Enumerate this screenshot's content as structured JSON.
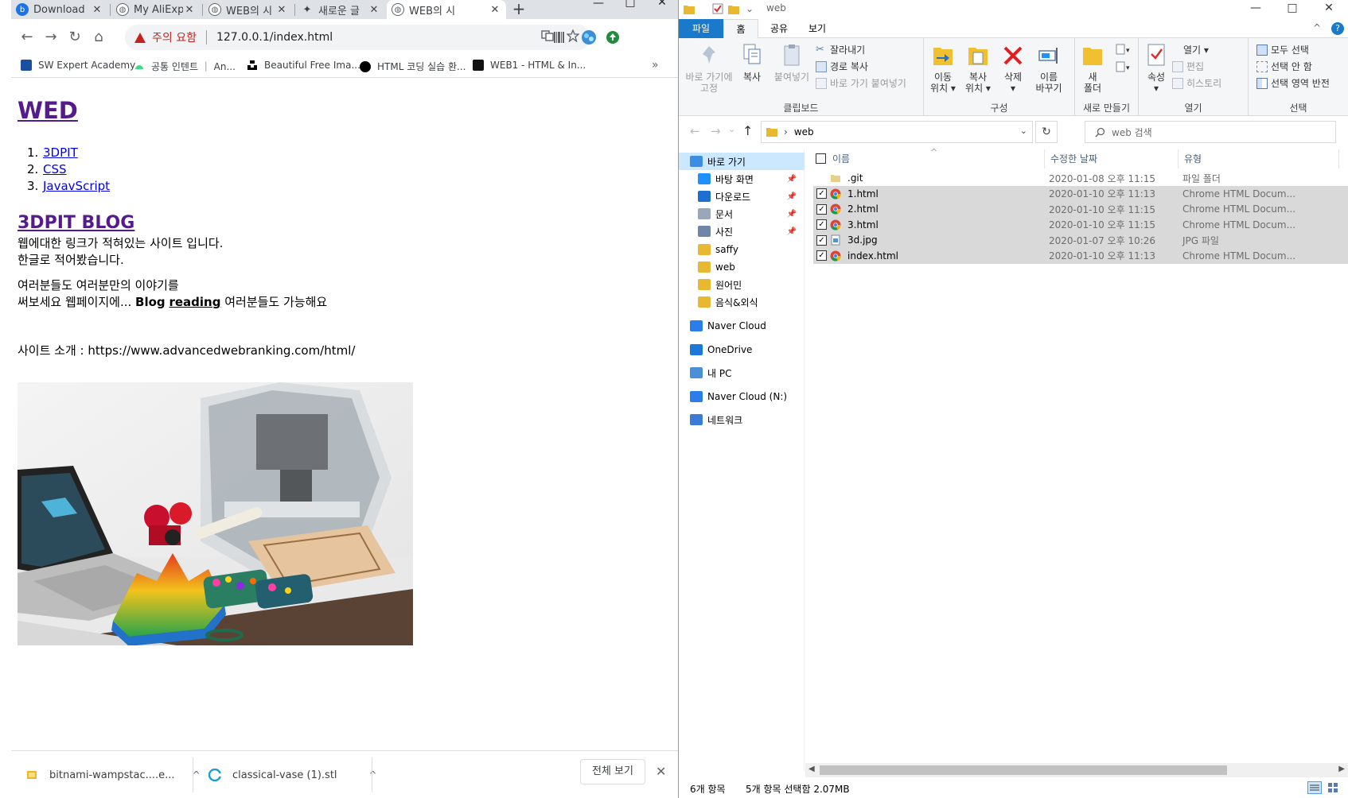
{
  "browser": {
    "tabs": [
      {
        "label": "Download",
        "fav_color": "#1a73e8",
        "fav_glyph": "b"
      },
      {
        "label": "My AliExp",
        "fav_color": "#5f6368",
        "fav_glyph": "◍"
      },
      {
        "label": "WEB의 시",
        "fav_color": "#5f6368",
        "fav_glyph": "◍"
      },
      {
        "label": "새로운 글",
        "fav_color": "#5f6368",
        "fav_glyph": "✦"
      },
      {
        "label": "WEB의 시",
        "fav_color": "#5f6368",
        "fav_glyph": "◍"
      }
    ],
    "newtab_glyph": "+",
    "window_buttons": {
      "minimize": "—",
      "maximize": "□",
      "close": "✕"
    },
    "nav": {
      "back": "←",
      "forward": "→",
      "reload": "↻",
      "home": "⌂"
    },
    "security_label": "주의 요함",
    "url": "127.0.0.1/index.html",
    "bookmarks": [
      {
        "label": "SW Expert Academy",
        "color": "#1a4fa0"
      },
      {
        "label": "공통 인텐트 ｜ An...",
        "color": "#3ddc84"
      },
      {
        "label": "Beautiful Free Ima...",
        "color": "#000000"
      },
      {
        "label": "HTML 코딩 실습 환...",
        "color": "#000000"
      },
      {
        "label": "WEB1 - HTML & In...",
        "color": "#111111"
      }
    ],
    "bookmarks_more": "»"
  },
  "page": {
    "heading": "WED",
    "list": [
      {
        "num": "1.",
        "label": "3DPIT"
      },
      {
        "num": "2.",
        "label": "CSS"
      },
      {
        "num": "3.",
        "label": "JavavScript"
      }
    ],
    "blog_heading": "3DPIT BLOG",
    "para1_line1": "웹에대한 링크가 적혀있는 사이트 입니다.",
    "para1_line2": "한글로 적어봤습니다.",
    "para2_line1": "여러분들도 여러분만의 이야기를",
    "para2_line2_a": "써보세요 웹페이지에... ",
    "para2_bold": "Blog",
    "para2_underline": "reading",
    "para2_line2_b": " 여러분들도 가능해요",
    "site_intro": "사이트 소개 : https://www.advancedwebranking.com/html/"
  },
  "downloads": {
    "items": [
      {
        "label": "bitnami-wampstac....e...",
        "chevron": "^"
      },
      {
        "label": "classical-vase (1).stl",
        "chevron": "^"
      }
    ],
    "show_all": "전체 보기",
    "close": "✕"
  },
  "explorer": {
    "title_path": "web",
    "window_buttons": {
      "minimize": "—",
      "maximize": "□",
      "close": "✕"
    },
    "ribbon_tabs": [
      "파일",
      "홈",
      "공유",
      "보기"
    ],
    "help_glyph": "?",
    "collapse_glyph": "^",
    "groups": {
      "clipboard": {
        "label": "클립보드",
        "pin_line1": "바로 가기에",
        "pin_line2": "고정",
        "copy": "복사",
        "paste": "붙여넣기",
        "cut": "잘라내기",
        "copy_path": "경로 복사",
        "paste_shortcut": "바로 가기 붙여넣기"
      },
      "organize": {
        "label": "구성",
        "move_line1": "이동",
        "move_line2": "위치 ▾",
        "copyto_line1": "복사",
        "copyto_line2": "위치 ▾",
        "delete_line1": "삭제",
        "delete_line2": "▾",
        "rename_line1": "이름",
        "rename_line2": "바꾸기"
      },
      "new": {
        "label": "새로 만들기",
        "folder_line1": "새",
        "folder_line2": "폴더"
      },
      "open": {
        "label": "열기",
        "props_line1": "속성",
        "props_line2": "▾",
        "open": "열기 ▾",
        "edit": "편집",
        "history": "히스토리"
      },
      "select": {
        "label": "선택",
        "all": "모두 선택",
        "none": "선택 안 함",
        "invert": "선택 영역 반전"
      }
    },
    "address": {
      "back": "←",
      "forward": "→",
      "recent": "⌄",
      "up": "↑",
      "sep": "›",
      "path": "web",
      "dropdown": "⌄",
      "refresh": "↻"
    },
    "search_placeholder": "web 검색",
    "nav": [
      {
        "label": "바로 가기",
        "color": "#3c8fe0",
        "pin": "",
        "sel": true
      },
      {
        "label": "바탕 화면",
        "color": "#1e90ff",
        "pin": "📌",
        "sel": false
      },
      {
        "label": "다운로드",
        "color": "#1e6fd0",
        "pin": "📌",
        "sel": false
      },
      {
        "label": "문서",
        "color": "#9aa7b8",
        "pin": "📌",
        "sel": false
      },
      {
        "label": "사진",
        "color": "#6f86a8",
        "pin": "📌",
        "sel": false
      },
      {
        "label": "saffy",
        "color": "#e8b830",
        "pin": "",
        "sel": false
      },
      {
        "label": "web",
        "color": "#e8b830",
        "pin": "",
        "sel": false
      },
      {
        "label": "원어민",
        "color": "#e8b830",
        "pin": "",
        "sel": false
      },
      {
        "label": "음식&외식",
        "color": "#e8b830",
        "pin": "",
        "sel": false
      },
      {
        "label": "Naver Cloud",
        "color": "#2b7de9",
        "pin": "",
        "sel": false
      },
      {
        "label": "OneDrive",
        "color": "#1b78d8",
        "pin": "",
        "sel": false
      },
      {
        "label": "내 PC",
        "color": "#4a90d9",
        "pin": "",
        "sel": false
      },
      {
        "label": "Naver Cloud (N:)",
        "color": "#2b7de9",
        "pin": "",
        "sel": false
      },
      {
        "label": "네트워크",
        "color": "#3a7bd5",
        "pin": "",
        "sel": false
      }
    ],
    "columns": {
      "name": "이름",
      "date": "수정한 날짜",
      "type": "유형",
      "sort_glyph": "^"
    },
    "files": [
      {
        "name": ".git",
        "date": "2020-01-08 오후 11:15",
        "type": "파일 폴더",
        "kind": "folder",
        "checked": false,
        "check": ""
      },
      {
        "name": "1.html",
        "date": "2020-01-10 오후 11:13",
        "type": "Chrome HTML Docum...",
        "kind": "chrome",
        "checked": true,
        "check": "✓"
      },
      {
        "name": "2.html",
        "date": "2020-01-10 오후 11:15",
        "type": "Chrome HTML Docum...",
        "kind": "chrome",
        "checked": true,
        "check": "✓"
      },
      {
        "name": "3.html",
        "date": "2020-01-10 오후 11:15",
        "type": "Chrome HTML Docum...",
        "kind": "chrome",
        "checked": true,
        "check": "✓"
      },
      {
        "name": "3d.jpg",
        "date": "2020-01-07 오후 10:26",
        "type": "JPG 파일",
        "kind": "jpg",
        "checked": true,
        "check": "✓"
      },
      {
        "name": "index.html",
        "date": "2020-01-10 오후 11:13",
        "type": "Chrome HTML Docum...",
        "kind": "chrome",
        "checked": true,
        "check": "✓"
      }
    ],
    "status_items": "6개 항목",
    "status_selected": "5개 항목 선택함 2.07MB"
  }
}
